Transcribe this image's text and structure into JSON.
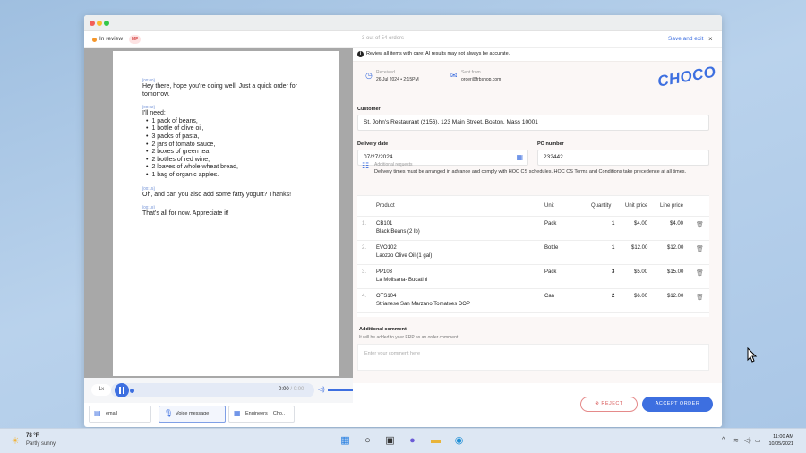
{
  "header": {
    "status": "In review",
    "user_initials": "MF",
    "order_count": "3 out of 54 orders",
    "save_exit": "Save and exit",
    "close": "×"
  },
  "transcript": [
    {
      "ts": "[00:00]",
      "text": "Hey there, hope you're doing well. Just a quick order for tomorrow."
    },
    {
      "ts": "[00:02]",
      "text": "I'll need:",
      "items": [
        "1 pack of beans,",
        "1 bottle of olive oil,",
        "3 packs of pasta,",
        "2 jars of tomato sauce,",
        "2 boxes of green tea,",
        "2 bottles of red wine,",
        "2 loaves of whole wheat bread,",
        "1 bag of organic apples."
      ]
    },
    {
      "ts": "[00:15]",
      "text": "Oh, and can you also add some fatty yogurt? Thanks!"
    },
    {
      "ts": "[00:18]",
      "text": "That's all for now. Appreciate it!"
    }
  ],
  "audio": {
    "speed": "1x",
    "current": "0:00",
    "total": "/ 0:00",
    "progress": 0.0
  },
  "tabs": [
    {
      "label": "email",
      "icon": "email-icon"
    },
    {
      "label": "Voice message",
      "icon": "microphone-icon"
    },
    {
      "label": "Engineers _ Cho..",
      "icon": "document-icon"
    }
  ],
  "notice": "Review all items with care: AI results may not always be accurate.",
  "received": {
    "label": "Received",
    "value": "26 Jul 2024 • 2:15PM"
  },
  "sent_from": {
    "label": "Sent from",
    "value": "order@frbshop.com"
  },
  "logo": "CHOCO",
  "customer": {
    "label": "Customer",
    "value": "St. John's Restaurant (2156), 123 Main Street, Boston, Mass 10001"
  },
  "delivery_date": {
    "label": "Delivery date",
    "value": "07/27/2024"
  },
  "po_number": {
    "label": "PO number",
    "value": "232442"
  },
  "additional_requests": {
    "label": "Additional requests",
    "text": "Delivery times must be arranged in advance and comply with HOC CS schedules. HOC CS Terms and Conditions take precedence at all times."
  },
  "table": {
    "headers": [
      "Product",
      "Unit",
      "Quantity",
      "Unit price",
      "Line price"
    ],
    "rows": [
      {
        "n": "1.",
        "code": "CB101",
        "name": "Black Beans (2 lb)",
        "unit": "Pack",
        "qty": "1",
        "price": "$4.00",
        "line": "$4.00"
      },
      {
        "n": "2.",
        "code": "EVO102",
        "name": "Laozzo Olive Oil (1 gal)",
        "unit": "Bottle",
        "qty": "1",
        "price": "$12.00",
        "line": "$12.00"
      },
      {
        "n": "3.",
        "code": "PP103",
        "name": "La Molisana- Bucatini",
        "unit": "Pack",
        "qty": "3",
        "price": "$5.00",
        "line": "$15.00"
      },
      {
        "n": "4.",
        "code": "OTS104",
        "name": "Strianese San Marzano Tomatoes DOP",
        "unit": "Can",
        "qty": "2",
        "price": "$6.00",
        "line": "$12.00"
      }
    ]
  },
  "comment": {
    "label": "Additional comment",
    "sub": "It will be added to your ERP as an order comment.",
    "placeholder": "Enter your comment here"
  },
  "buttons": {
    "reject": "REJECT",
    "accept": "ACCEPT ORDER"
  },
  "taskbar": {
    "temp": "78 °F",
    "condition": "Partly sunny",
    "time": "11:00 AM",
    "date": "10/05/2021"
  }
}
